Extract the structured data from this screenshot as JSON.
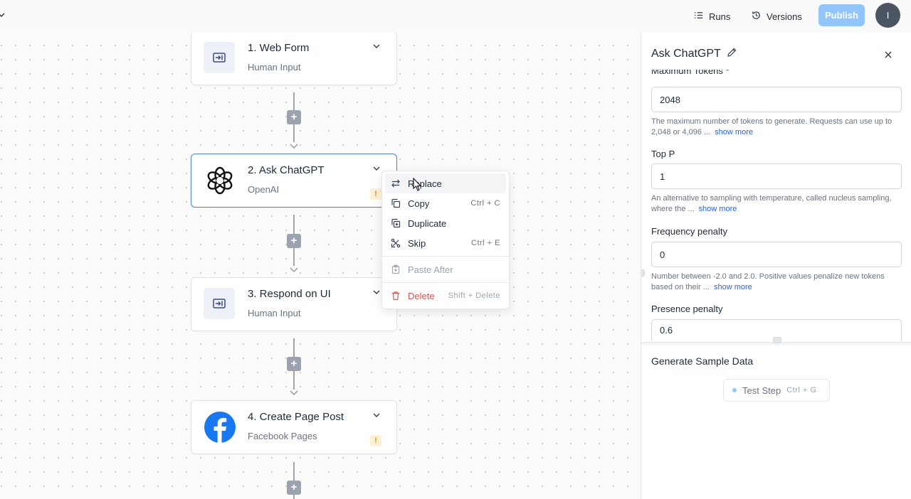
{
  "topbar": {
    "runs_label": "Runs",
    "versions_label": "Versions",
    "publish_label": "Publish",
    "avatar_initial": "I"
  },
  "flow": {
    "steps": [
      {
        "title": "1. Web Form",
        "subtitle": "Human Input",
        "icon": "form-input-icon",
        "warning": false
      },
      {
        "title": "2. Ask ChatGPT",
        "subtitle": "OpenAI",
        "icon": "openai-logo-icon",
        "warning": true
      },
      {
        "title": "3. Respond on UI",
        "subtitle": "Human Input",
        "icon": "form-input-icon",
        "warning": false
      },
      {
        "title": "4. Create Page Post",
        "subtitle": "Facebook Pages",
        "icon": "facebook-logo-icon",
        "warning": true
      }
    ],
    "warning_symbol": "!"
  },
  "context_menu": {
    "items": [
      {
        "label": "Replace",
        "shortcut": "",
        "icon": "replace-icon"
      },
      {
        "label": "Copy",
        "shortcut": "Ctrl + C",
        "icon": "copy-icon"
      },
      {
        "label": "Duplicate",
        "shortcut": "",
        "icon": "duplicate-icon"
      },
      {
        "label": "Skip",
        "shortcut": "Ctrl + E",
        "icon": "skip-icon"
      },
      {
        "label": "Paste After",
        "shortcut": "",
        "icon": "paste-icon"
      },
      {
        "label": "Delete",
        "shortcut": "Shift + Delete",
        "icon": "trash-icon"
      }
    ]
  },
  "panel": {
    "title": "Ask ChatGPT",
    "cut_label": "Maximum Tokens *",
    "fields": [
      {
        "label": "",
        "value": "2048",
        "help": "The maximum number of tokens to generate. Requests can use up to 2,048 or 4,096 ...",
        "show_more": "show more"
      },
      {
        "label": "Top P",
        "value": "1",
        "help": "An alternative to sampling with temperature, called nucleus sampling, where the ...",
        "show_more": "show more"
      },
      {
        "label": "Frequency penalty",
        "value": "0",
        "help": "Number between -2.0 and 2.0. Positive values penalize new tokens based on their ...",
        "show_more": "show more"
      },
      {
        "label": "Presence penalty",
        "value": "0.6"
      }
    ],
    "sample_title": "Generate Sample Data",
    "test_step_label": "Test Step",
    "test_step_shortcut": "Ctrl + G"
  },
  "colors": {
    "accent": "#4b7fd6",
    "publish_bg": "#93c5fd",
    "danger": "#d9534f",
    "link": "#2563eb"
  }
}
